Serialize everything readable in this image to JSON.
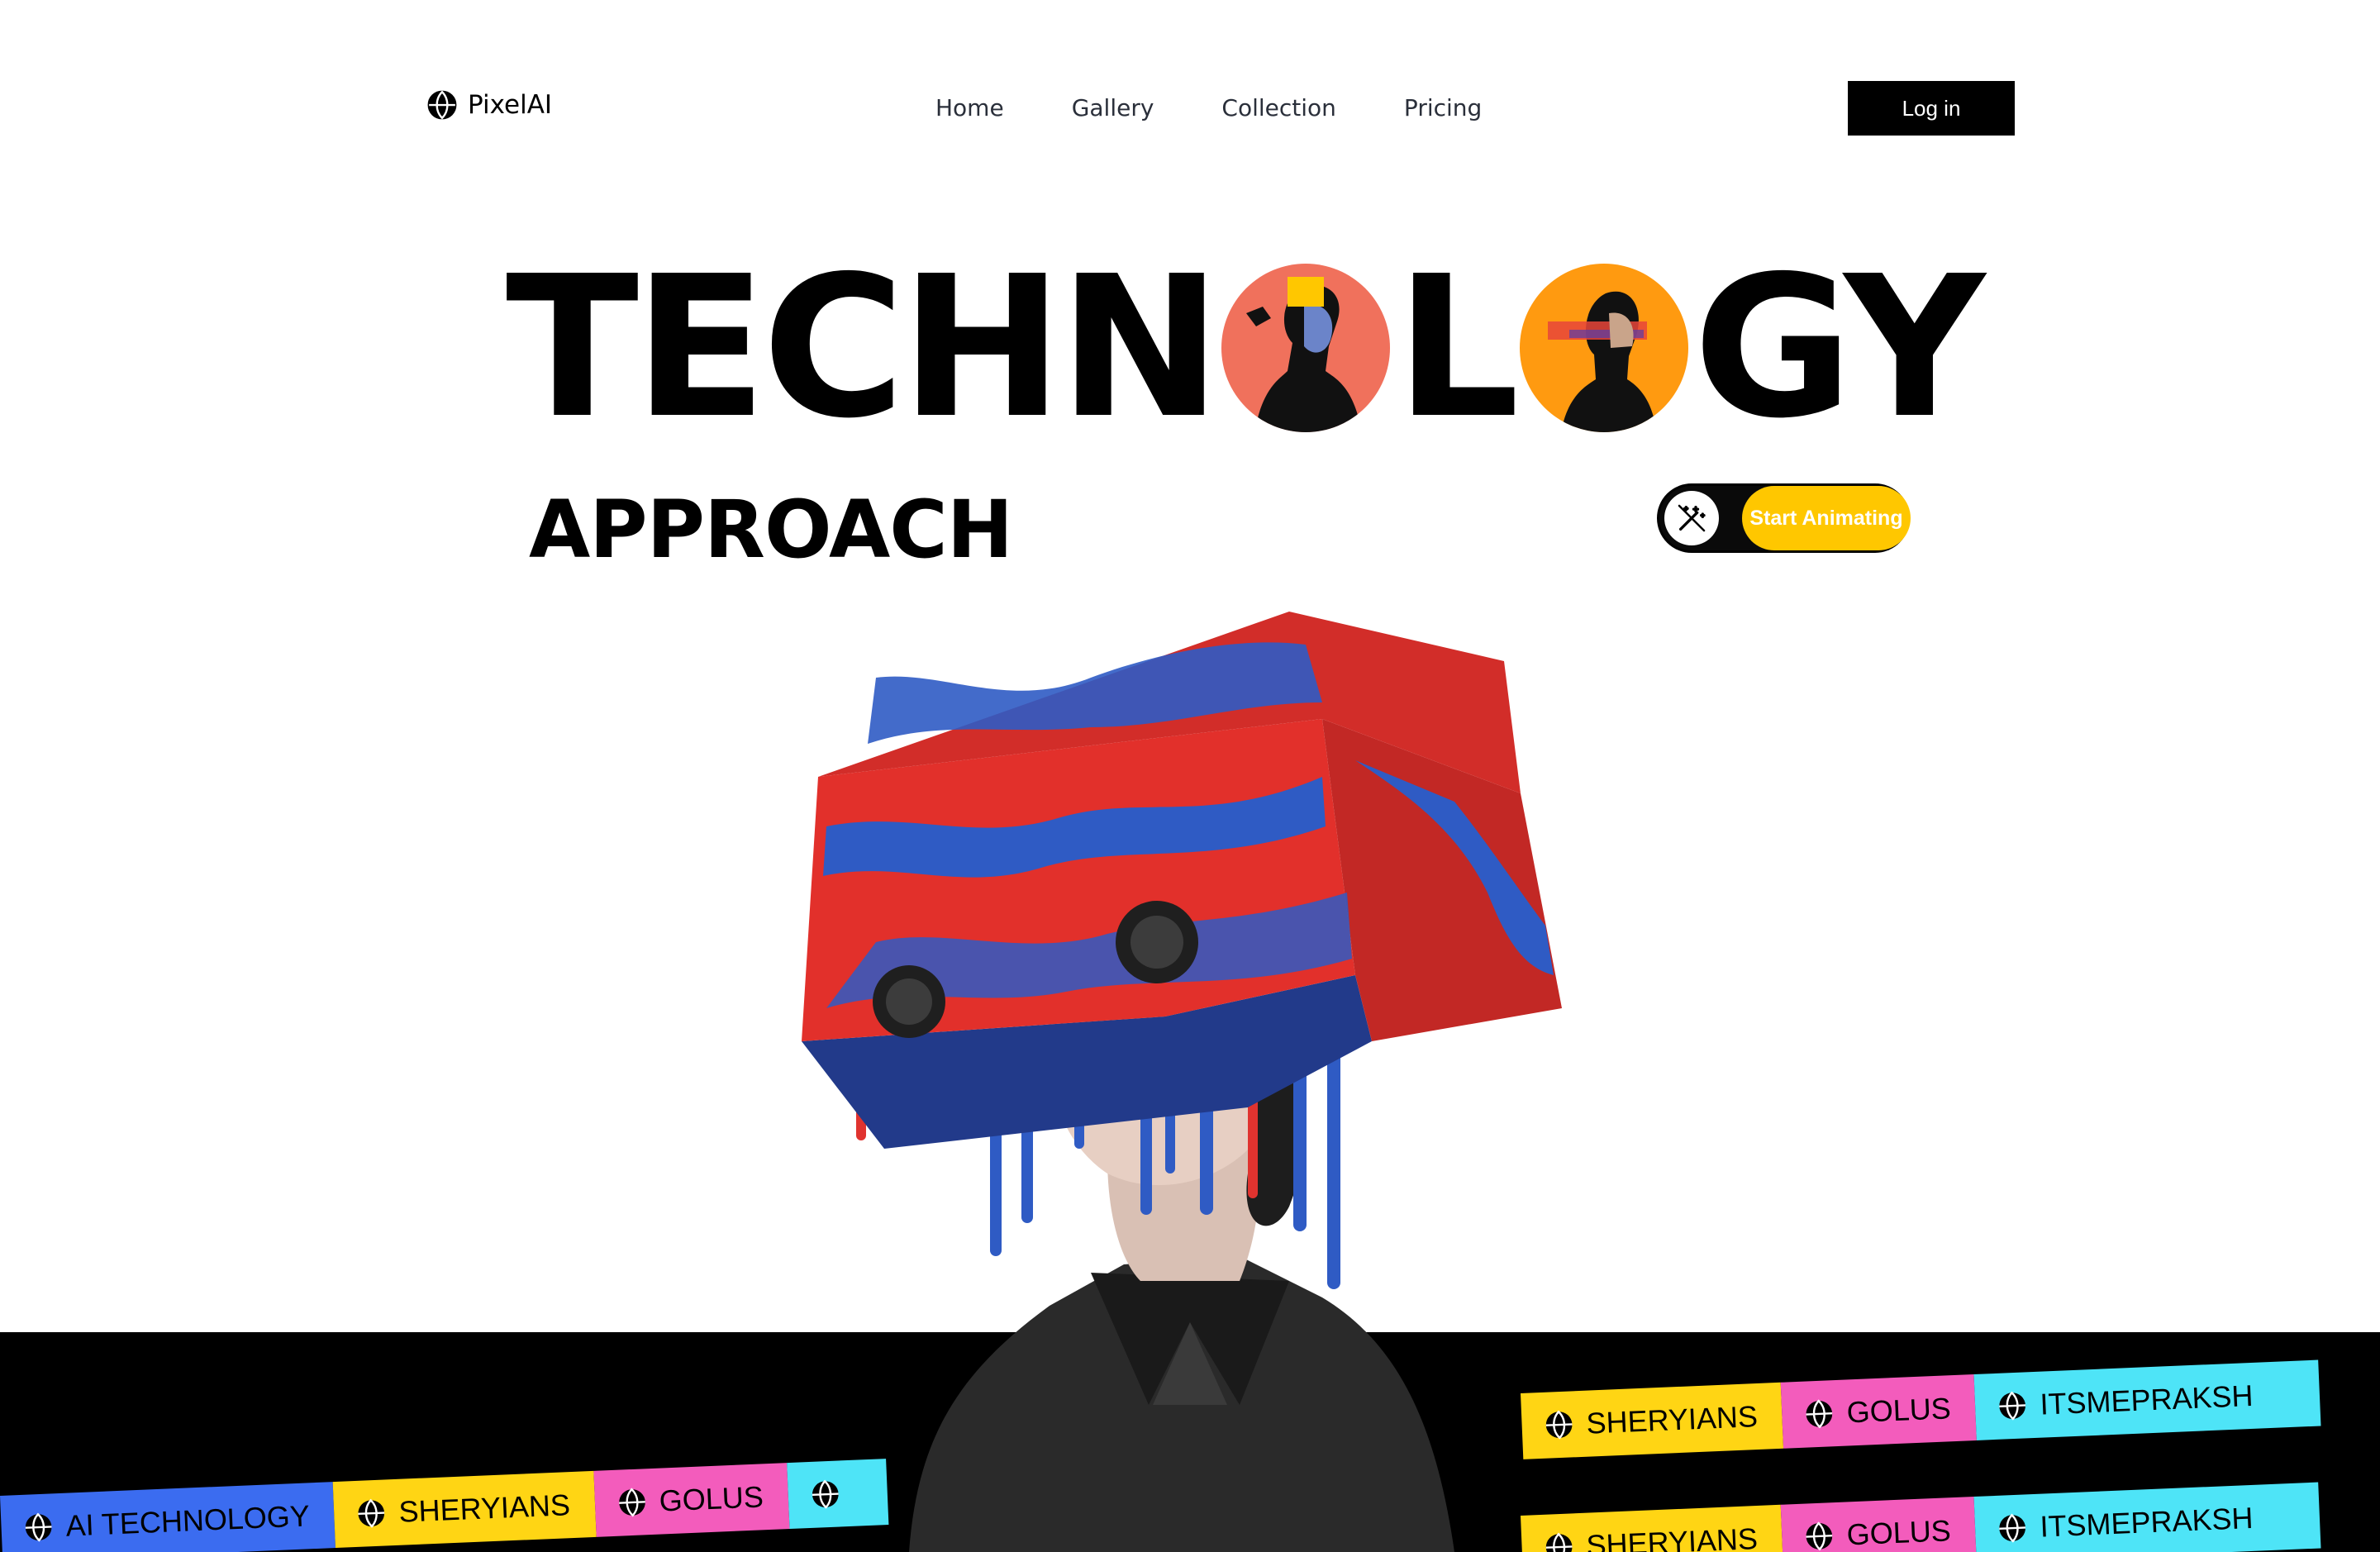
{
  "brand": {
    "name": "PixelAI",
    "icon": "globe-icon"
  },
  "nav": {
    "links": [
      "Home",
      "Gallery",
      "Collection",
      "Pricing"
    ],
    "login_label": "Log in"
  },
  "hero": {
    "title_part1": "TECHN",
    "title_part2": "L",
    "title_part3": "GY",
    "subtitle": "APPROACH",
    "cta_label": "Start Animating",
    "cta_icon": "magic-wand-icon"
  },
  "colors": {
    "accent_yellow": "#ffc700",
    "o1": "#f0715c",
    "o2": "#ff9a10",
    "band": "#000000"
  },
  "ticker_upper": {
    "tags": [
      {
        "label": "SHERYIANS",
        "color": "yellow"
      },
      {
        "label": "GOLUS",
        "color": "pink"
      },
      {
        "label": "ITSMEPRAKSH",
        "color": "cyan"
      }
    ]
  },
  "ticker_lower_right": {
    "tags": [
      {
        "label": "SHERYIANS",
        "color": "yellow"
      },
      {
        "label": "GOLUS",
        "color": "pink"
      },
      {
        "label": "ITSMEPRAKSH",
        "color": "cyan"
      }
    ]
  },
  "ticker_left": {
    "tags": [
      {
        "label": "AI TECHNOLOGY",
        "color": "blue"
      },
      {
        "label": "SHERYIANS",
        "color": "yellow"
      },
      {
        "label": "GOLUS",
        "color": "pink"
      },
      {
        "label": "",
        "color": "cyan"
      }
    ]
  }
}
